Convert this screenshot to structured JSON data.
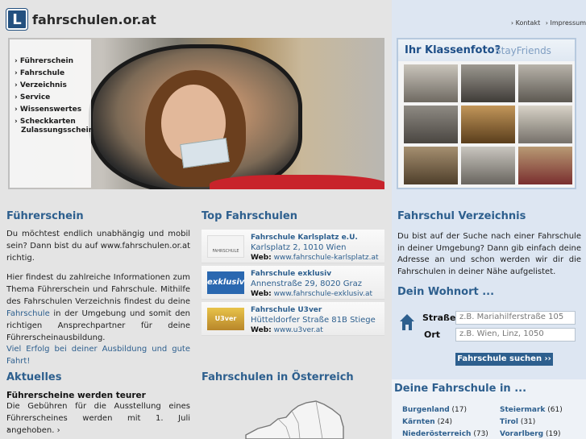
{
  "brand": {
    "logo_letter": "L",
    "site_name": "fahrschulen.or.at"
  },
  "toplinks": [
    "› Kontakt",
    "› Impressum"
  ],
  "hero_menu": [
    "› Führerschein",
    "› Fahrschule",
    "› Verzeichnis",
    "› Service",
    "› Wissenswertes",
    "› Scheckkarten",
    "Zulassungsschein"
  ],
  "klassenfoto": {
    "title": "Ihr Klassenfoto?",
    "brand": "StayFriends"
  },
  "fuehrerschein": {
    "heading": "Führerschein",
    "p1": "Du möchtest endlich unabhängig und mobil sein? Dann bist du auf www.fahrschulen.or.at richtig.",
    "p2_before": "Hier findest du zahlreiche Informationen zum Thema Führerschein und Fahrschule. Mithilfe des Fahrschulen Verzeichnis findest du deine",
    "p2_link": "Fahrschule",
    "p2_after": "in der Umgebung und somit den richtigen Ansprechpartner für deine Führerscheinausbildung.",
    "p3": "Viel Erfolg bei deiner Ausbildung und gute Fahrt!"
  },
  "aktuelles": {
    "heading": "Aktuelles",
    "title": "Führerscheine werden teurer",
    "text": "Die Gebühren für die Ausstellung eines Führerscheines werden mit 1. Juli angehoben. ›",
    "more": "›"
  },
  "top_fahrschulen": {
    "heading": "Top Fahrschulen",
    "web_label": "Web:",
    "items": [
      {
        "name": "Fahrschule Karlsplatz e.U.",
        "address": "Karlsplatz 2, 1010 Wien",
        "web": "www.fahrschule-karlsplatz.at",
        "thumb_text": "FAHRSCHULE KARLSPLATZ"
      },
      {
        "name": "Fahrschule exklusiv",
        "address": "Annenstraße 29, 8020 Graz",
        "web": "www.fahrschule-exklusiv.at",
        "thumb_text": "exklusiv"
      },
      {
        "name": "Fahrschule U3ver",
        "address": "Hütteldorfer Straße 81B Stiege",
        "web": "www.u3ver.at",
        "thumb_text": "U3ver"
      }
    ]
  },
  "oesterreich": {
    "heading": "Fahrschulen in Österreich"
  },
  "verzeichnis": {
    "heading": "Fahrschul Verzeichnis",
    "text": "Du bist auf der Suche nach einer Fahrschule in deiner Umgebung? Dann gib einfach deine Adresse an und schon werden wir dir die Fahrschulen in deiner Nähe aufgelistet."
  },
  "wohnort": {
    "heading": "Dein Wohnort ...",
    "street_label": "Straße",
    "street_placeholder": "z.B. Mariahilferstraße 105",
    "city_label": "Ort",
    "city_placeholder": "z.B. Wien, Linz, 1050",
    "submit": "Fahrschule suchen ››"
  },
  "deine_fahrschule": {
    "heading": "Deine Fahrschule in ...",
    "regions": [
      {
        "name": "Burgenland",
        "count": "(17)"
      },
      {
        "name": "Kärnten",
        "count": "(24)"
      },
      {
        "name": "Niederösterreich",
        "count": "(73)"
      },
      {
        "name": "Steiermark",
        "count": "(61)"
      },
      {
        "name": "Tirol",
        "count": "(31)"
      },
      {
        "name": "Vorarlberg",
        "count": "(19)"
      }
    ]
  },
  "colors": {
    "link": "#2d5f8e",
    "button": "#2d5f8e",
    "sidebar_bg": "#dde6f2",
    "main_bg": "#e4e4e4"
  }
}
